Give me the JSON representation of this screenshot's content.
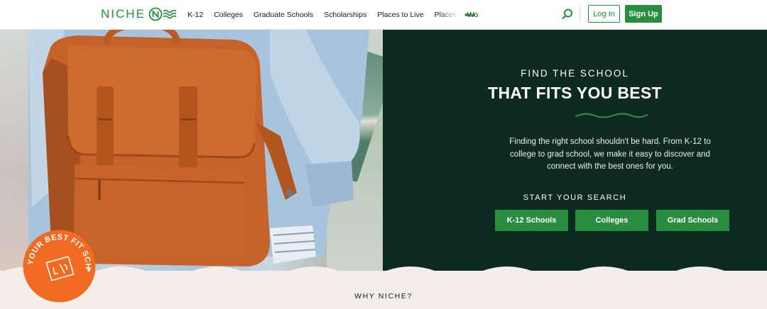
{
  "brand": {
    "name": "NICHE",
    "color": "#2a8c3f"
  },
  "nav": {
    "items": [
      {
        "label": "K-12"
      },
      {
        "label": "Colleges"
      },
      {
        "label": "Graduate Schools"
      },
      {
        "label": "Scholarships"
      },
      {
        "label": "Places to Live"
      },
      {
        "label": "Places to Work"
      }
    ],
    "more_icon": "ellipsis-icon",
    "search_icon": "search-icon"
  },
  "auth": {
    "login_label": "Log In",
    "signup_label": "Sign Up"
  },
  "hero": {
    "eyebrow": "FIND THE SCHOOL",
    "headline": "THAT FITS YOU BEST",
    "blurb": "Finding the right school shouldn't be hard. From K-12 to college to grad school, we make it easy to discover and connect with the best ones for you.",
    "search_label": "START YOUR SEARCH",
    "buttons": [
      {
        "label": "K-12 Schools"
      },
      {
        "label": "Colleges"
      },
      {
        "label": "Grad Schools"
      }
    ],
    "panel_color": "#0d2a21",
    "image": "student-with-orange-backpack"
  },
  "badge": {
    "text": "FIND YOUR BEST FIT SCHOOL",
    "color": "#f26b21"
  },
  "section": {
    "why_label": "WHY NICHE?"
  }
}
